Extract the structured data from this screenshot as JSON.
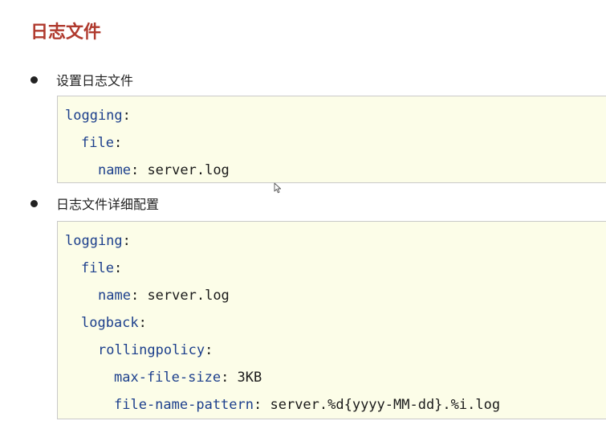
{
  "page": {
    "title": "日志文件"
  },
  "sections": [
    {
      "bullet": "设置日志文件",
      "code": [
        {
          "key": "logging",
          "sep": ":",
          "value": ""
        },
        {
          "key": "file",
          "sep": ":",
          "value": ""
        },
        {
          "key": "name",
          "sep": ":",
          "value": " server.log"
        }
      ]
    },
    {
      "bullet": "日志文件详细配置",
      "code": [
        {
          "key": "logging",
          "sep": ":",
          "value": ""
        },
        {
          "key": "file",
          "sep": ":",
          "value": ""
        },
        {
          "key": "name",
          "sep": ":",
          "value": " server.log"
        },
        {
          "key": "logback",
          "sep": ":",
          "value": ""
        },
        {
          "key": "rollingpolicy",
          "sep": ":",
          "value": ""
        },
        {
          "key": "max-file-size",
          "sep": ":",
          "value": " 3KB"
        },
        {
          "key": "file-name-pattern",
          "sep": ":",
          "value": " server.%d{yyyy-MM-dd}.%i.log"
        }
      ]
    }
  ],
  "colors": {
    "title": "#b03a2e",
    "code_key": "#1c3f8c",
    "code_background": "#fcfde8",
    "code_border": "#c9c9c9"
  },
  "icons": {
    "pointer": "mouse-pointer-icon"
  }
}
